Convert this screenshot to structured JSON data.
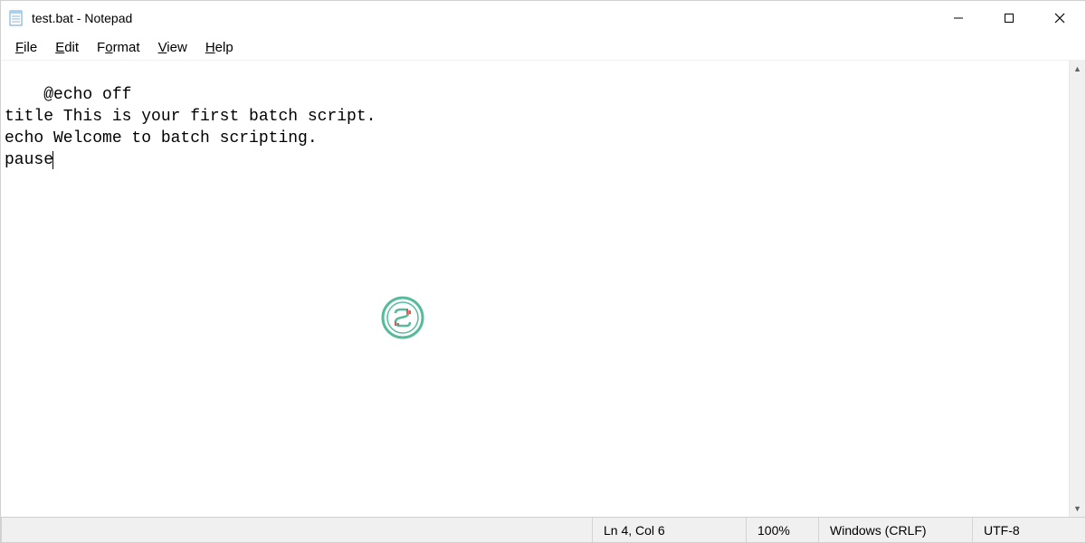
{
  "titlebar": {
    "title": "test.bat - Notepad"
  },
  "menu": {
    "file": "File",
    "edit": "Edit",
    "format": "Format",
    "view": "View",
    "help": "Help"
  },
  "editor": {
    "content": "@echo off\ntitle This is your first batch script.\necho Welcome to batch scripting.\npause"
  },
  "statusbar": {
    "position": "Ln 4, Col 6",
    "zoom": "100%",
    "eol": "Windows (CRLF)",
    "encoding": "UTF-8"
  }
}
